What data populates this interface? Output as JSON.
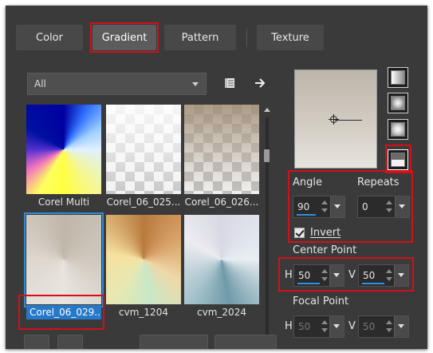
{
  "tabs": [
    {
      "label": "Color",
      "active": false
    },
    {
      "label": "Gradient",
      "active": true
    },
    {
      "label": "Pattern",
      "active": false
    },
    {
      "label": "Texture",
      "active": false
    }
  ],
  "filter": {
    "selected": "All"
  },
  "toolbar_icons": [
    "library-icon",
    "arrow-right-icon"
  ],
  "gradients": [
    {
      "label": "Corel Multi",
      "icon": "gradient-swatch"
    },
    {
      "label": "Corel_06_025...",
      "icon": "gradient-swatch"
    },
    {
      "label": "Corel_06_026...",
      "icon": "gradient-swatch"
    },
    {
      "label": "Corel_06_029...",
      "icon": "gradient-swatch",
      "selected": true
    },
    {
      "label": "cvm_1204",
      "icon": "gradient-swatch"
    },
    {
      "label": "cvm_2024",
      "icon": "gradient-swatch"
    }
  ],
  "gradient_types": [
    "linear-gradient-icon",
    "rectangular-gradient-icon",
    "sunburst-gradient-icon",
    "radial-gradient-icon"
  ],
  "angle": {
    "label": "Angle",
    "value": "90"
  },
  "repeats": {
    "label": "Repeats",
    "value": "0"
  },
  "invert": {
    "label": "Invert",
    "checked": true
  },
  "center_point": {
    "label": "Center Point",
    "h_label": "H",
    "h_value": "50",
    "v_label": "V",
    "v_value": "50"
  },
  "focal_point": {
    "label": "Focal Point",
    "h_label": "H",
    "h_value": "50",
    "v_label": "V",
    "v_value": "50"
  },
  "colors": {
    "panel": "#3a3a3a",
    "highlight": "#d31019",
    "selection": "#2678c8"
  }
}
